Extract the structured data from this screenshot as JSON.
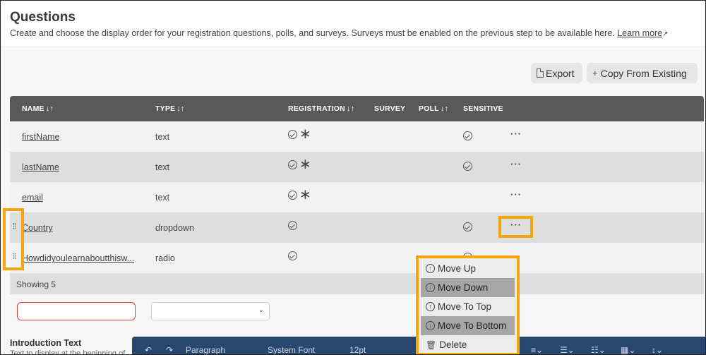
{
  "header": {
    "title": "Questions",
    "subtitle": "Create and choose the display order for your registration questions, polls, and surveys. Surveys must be enabled on the previous step to be available here.",
    "learn_more": "Learn more"
  },
  "toolbar": {
    "export_label": "Export",
    "copy_label": "Copy From Existing"
  },
  "table": {
    "columns": {
      "name": "NAME",
      "type": "TYPE",
      "registration": "REGISTRATION",
      "survey": "SURVEY",
      "poll": "POLL",
      "sensitive": "SENSITIVE"
    },
    "rows": [
      {
        "name": "firstName",
        "type": "text",
        "registration": true,
        "required": true,
        "sensitive": true
      },
      {
        "name": "lastName",
        "type": "text",
        "registration": true,
        "required": true,
        "sensitive": true
      },
      {
        "name": "email",
        "type": "text",
        "registration": true,
        "required": true,
        "sensitive": false
      },
      {
        "name": "Country",
        "type": "dropdown",
        "registration": true,
        "required": false,
        "sensitive": true
      },
      {
        "name": "Howdidyoulearnaboutthisw...",
        "type": "radio",
        "registration": true,
        "required": false,
        "sensitive": true
      }
    ],
    "more_label": "···",
    "showing": "Showing 5"
  },
  "context_menu": {
    "items": [
      "Move Up",
      "Move Down",
      "Move To Top",
      "Move To Bottom",
      "Delete"
    ]
  },
  "intro": {
    "title": "Introduction Text",
    "description": "Text to display at the beginning of"
  },
  "editor_toolbar": {
    "paragraph": "Paragraph",
    "font": "System Font",
    "size": "12pt"
  },
  "colors": {
    "header_bg": "#595959",
    "highlight": "#f5a50d",
    "editor_bg": "#27476e",
    "error_border": "#d93a3a"
  }
}
